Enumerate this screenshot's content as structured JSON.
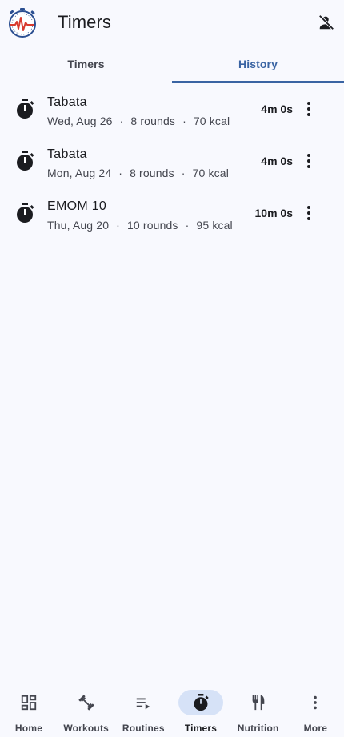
{
  "header": {
    "title": "Timers"
  },
  "tabs": [
    {
      "label": "Timers",
      "active": false
    },
    {
      "label": "History",
      "active": true
    }
  ],
  "history": [
    {
      "name": "Tabata",
      "date": "Wed, Aug 26",
      "rounds": "8 rounds",
      "kcal": "70 kcal",
      "duration": "4m 0s"
    },
    {
      "name": "Tabata",
      "date": "Mon, Aug 24",
      "rounds": "8 rounds",
      "kcal": "70 kcal",
      "duration": "4m 0s"
    },
    {
      "name": "EMOM 10",
      "date": "Thu, Aug 20",
      "rounds": "10 rounds",
      "kcal": "95 kcal",
      "duration": "10m 0s"
    }
  ],
  "bottom_nav": [
    {
      "label": "Home",
      "icon": "dashboard-icon",
      "active": false
    },
    {
      "label": "Workouts",
      "icon": "dumbbell-icon",
      "active": false
    },
    {
      "label": "Routines",
      "icon": "playlist-icon",
      "active": false
    },
    {
      "label": "Timers",
      "icon": "stopwatch-icon",
      "active": true
    },
    {
      "label": "Nutrition",
      "icon": "utensils-icon",
      "active": false
    },
    {
      "label": "More",
      "icon": "more-vertical-icon",
      "active": false
    }
  ],
  "colors": {
    "accent": "#3a64a3",
    "active_pill": "#d6e2f7",
    "background": "#f8f9fe",
    "logo_red": "#d83a2e",
    "logo_blue": "#2b4f91"
  }
}
